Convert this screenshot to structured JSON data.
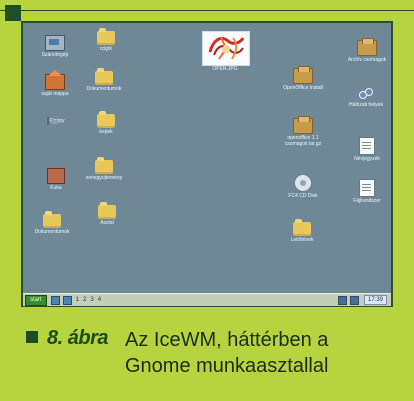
{
  "caption": {
    "label": "8. ábra",
    "text": "Az IceWM, háttérben a Gnome munkaasztallal"
  },
  "taskbar": {
    "start_label": "start",
    "workspaces": [
      "1",
      "2",
      "3",
      "4"
    ],
    "clock": "17:39"
  },
  "desktop": {
    "icons": [
      {
        "label": "Számítógép"
      },
      {
        "label": "rclgtk"
      },
      {
        "label": "saját mappa"
      },
      {
        "label": "Dokumentumok"
      },
      {
        "label": "Floppy"
      },
      {
        "label": "kepek"
      },
      {
        "label": "Kuka"
      },
      {
        "label": "zenegyujtemeny"
      },
      {
        "label": "Dokumentumok"
      },
      {
        "label": "Asztal"
      },
      {
        "label": "OPEN.JPG"
      },
      {
        "label": "OpenOffice Install"
      },
      {
        "label": "openoffice 1.1 csomagok tar.gz"
      },
      {
        "label": "FC4 CD Disk"
      },
      {
        "label": "Letöltések"
      },
      {
        "label": "Archív csomagok"
      },
      {
        "label": "Hálózati helyek"
      },
      {
        "label": "Névjegyzék"
      },
      {
        "label": "Fájlrendszer"
      }
    ]
  }
}
